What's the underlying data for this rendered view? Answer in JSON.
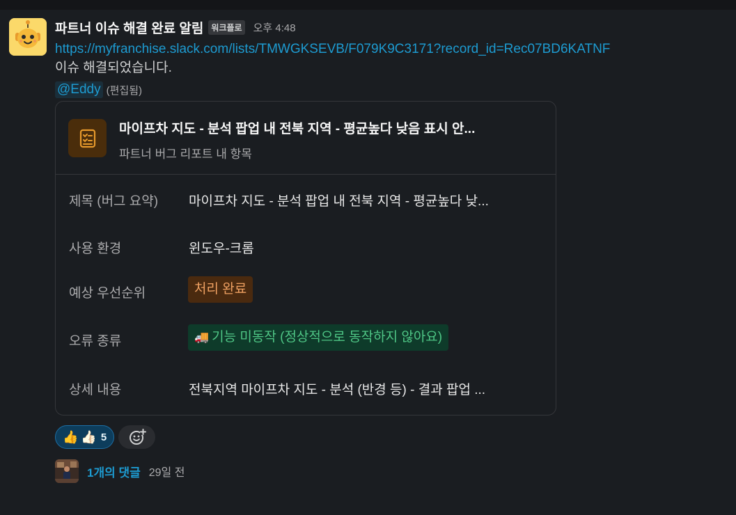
{
  "message": {
    "sender": "파트너 이슈 해결 완료 알림",
    "app_badge": "워크플로",
    "timestamp": "오후 4:48",
    "link": "https://myfranchise.slack.com/lists/TMWGKSEVB/F079K9C3171?record_id=Rec07BD6KATNF",
    "text": "이슈 해결되었습니다.",
    "mention": "@Eddy",
    "edited_label": "(편집됨)"
  },
  "card": {
    "icon": "checklist-icon",
    "title": "마이프차 지도 - 분석 팝업 내 전북 지역 - 평균높다 낮음 표시 안...",
    "subtitle": "파트너 버그 리포트 내 항목",
    "fields": [
      {
        "label": "제목 (버그 요약)",
        "value": "마이프차 지도 - 분석 팝업 내 전북 지역 - 평균높다 낮..."
      },
      {
        "label": "사용 환경",
        "value": "윈도우-크롬"
      },
      {
        "label": "예상 우선순위",
        "value": "처리 완료",
        "color": "#f0a162"
      },
      {
        "label": "오류 종류",
        "value": "기능 미동작 (정상적으로 동작하지 않아요)",
        "emoji": "🚚",
        "color": "#4fc786"
      },
      {
        "label": "상세 내용",
        "value": "전북지역  마이프차 지도 - 분석 (반경 등) -  결과 팝업 ..."
      }
    ]
  },
  "reactions": {
    "emojis": [
      "👍",
      "👍🏻"
    ],
    "count": "5",
    "add_icon": "add-reaction-icon"
  },
  "thread": {
    "count_label": "1개의 댓글",
    "time_label": "29일 전"
  }
}
